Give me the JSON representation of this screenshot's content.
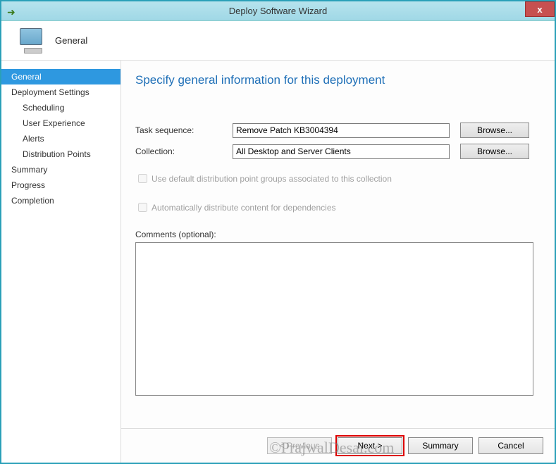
{
  "window": {
    "title": "Deploy Software Wizard",
    "close_glyph": "x"
  },
  "header": {
    "label": "General"
  },
  "sidebar": {
    "items": [
      {
        "label": "General",
        "selected": true,
        "sub": false
      },
      {
        "label": "Deployment Settings",
        "selected": false,
        "sub": false
      },
      {
        "label": "Scheduling",
        "selected": false,
        "sub": true
      },
      {
        "label": "User Experience",
        "selected": false,
        "sub": true
      },
      {
        "label": "Alerts",
        "selected": false,
        "sub": true
      },
      {
        "label": "Distribution Points",
        "selected": false,
        "sub": true
      },
      {
        "label": "Summary",
        "selected": false,
        "sub": false
      },
      {
        "label": "Progress",
        "selected": false,
        "sub": false
      },
      {
        "label": "Completion",
        "selected": false,
        "sub": false
      }
    ]
  },
  "content": {
    "title": "Specify general information for this deployment",
    "task_sequence_label": "Task sequence:",
    "task_sequence_value": "Remove Patch KB3004394",
    "collection_label": "Collection:",
    "collection_value": "All Desktop and Server Clients",
    "browse_label": "Browse...",
    "checkbox1_label": "Use default distribution point groups associated to this collection",
    "checkbox2_label": "Automatically distribute content for dependencies",
    "comments_label": "Comments (optional):"
  },
  "footer": {
    "previous": "< Previous",
    "next": "Next >",
    "summary": "Summary",
    "cancel": "Cancel"
  },
  "watermark": "©PrajwalDesai.com"
}
